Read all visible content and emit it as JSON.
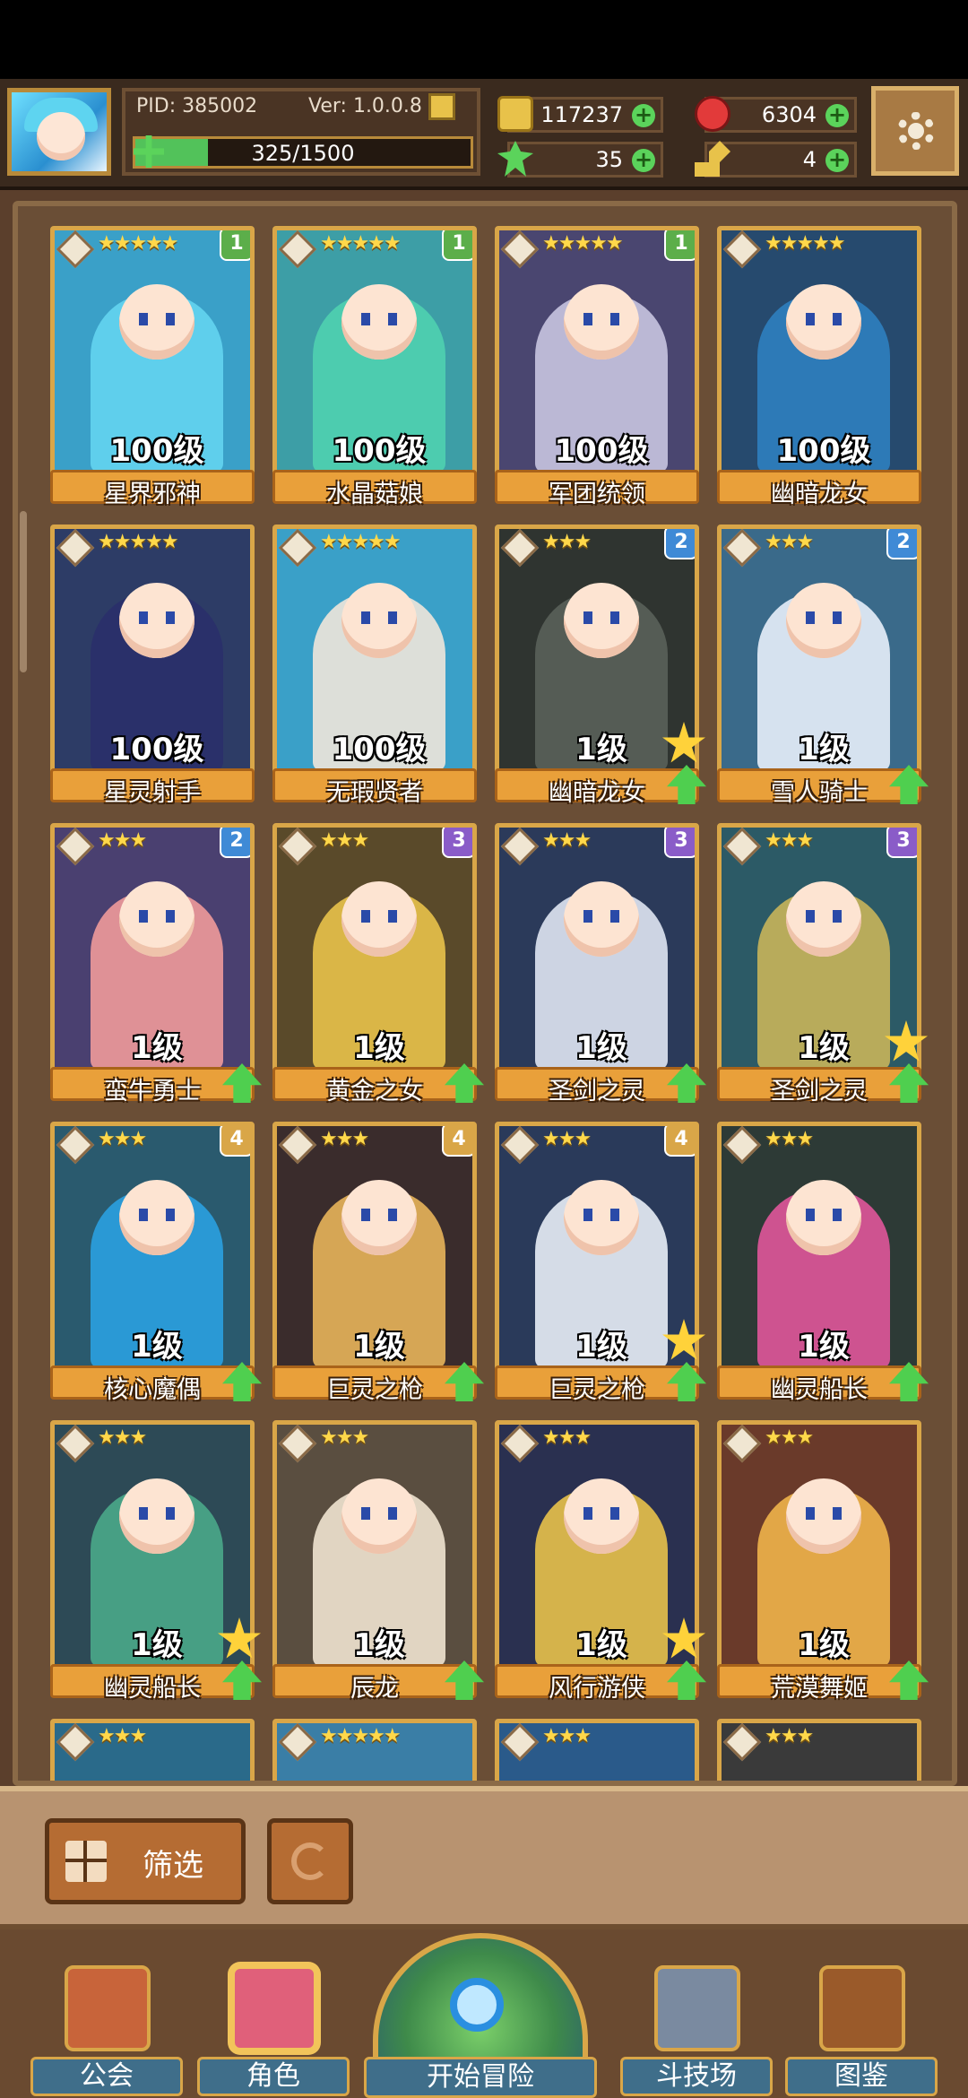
{
  "header": {
    "pid": "PID: 385002",
    "version": "Ver: 1.0.0.8",
    "exp_text": "325/1500",
    "exp_progress": 0.217,
    "gold": "117237",
    "gems": "6304",
    "clover": "35",
    "keys": "4"
  },
  "heroes": [
    {
      "name": "星界邪神",
      "level": "100级",
      "stars": "★★★★★",
      "tier": "1",
      "tier_color": "#5cae4a",
      "bg": "#3aa0c8",
      "hair": "#64d4ef"
    },
    {
      "name": "水晶菇娘",
      "level": "100级",
      "stars": "★★★★★",
      "tier": "1",
      "tier_color": "#5cae4a",
      "bg": "#3d9ea6",
      "hair": "#4fd0b0"
    },
    {
      "name": "军团统领",
      "level": "100级",
      "stars": "★★★★★",
      "tier": "1",
      "tier_color": "#5cae4a",
      "bg": "#4a4670",
      "hair": "#c8c4e0"
    },
    {
      "name": "幽暗龙女",
      "level": "100级",
      "stars": "★★★★★",
      "tier": "",
      "tier_color": "",
      "bg": "#264a6e",
      "hair": "#2f7fbf"
    },
    {
      "name": "星灵射手",
      "level": "100级",
      "stars": "★★★★★",
      "tier": "",
      "tier_color": "",
      "bg": "#2d3c66",
      "hair": "#2a2f6a"
    },
    {
      "name": "无瑕贤者",
      "level": "100级",
      "stars": "★★★★★",
      "tier": "",
      "tier_color": "",
      "bg": "#3aa0c8",
      "hair": "#efe6da"
    },
    {
      "name": "幽暗龙女",
      "level": "1级",
      "stars": "★★★",
      "tier": "2",
      "tier_color": "#3f8ad6",
      "bg": "#2f3430",
      "hair": "#5a605a"
    },
    {
      "name": "雪人骑士",
      "level": "1级",
      "stars": "★★★",
      "tier": "2",
      "tier_color": "#3f8ad6",
      "bg": "#3a6a8a",
      "hair": "#e8f0fa"
    },
    {
      "name": "蛮牛勇士",
      "level": "1级",
      "stars": "★★★",
      "tier": "2",
      "tier_color": "#3f8ad6",
      "bg": "#4a4070",
      "hair": "#f09a9a"
    },
    {
      "name": "黄金之女",
      "level": "1级",
      "stars": "★★★",
      "tier": "3",
      "tier_color": "#8a5cc8",
      "bg": "#5a4a2a",
      "hair": "#e8c24a"
    },
    {
      "name": "圣剑之灵",
      "level": "1级",
      "stars": "★★★",
      "tier": "3",
      "tier_color": "#8a5cc8",
      "bg": "#2b3a5a",
      "hair": "#dfe6f2"
    },
    {
      "name": "圣剑之灵",
      "level": "1级",
      "stars": "★★★",
      "tier": "3",
      "tier_color": "#8a5cc8",
      "bg": "#2c5a66",
      "hair": "#c8b45a"
    },
    {
      "name": "核心魔偶",
      "level": "1级",
      "stars": "★★★",
      "tier": "4",
      "tier_color": "#d9a648",
      "bg": "#2a5a6e",
      "hair": "#2aa0e0"
    },
    {
      "name": "巨灵之枪",
      "level": "1级",
      "stars": "★★★",
      "tier": "4",
      "tier_color": "#d9a648",
      "bg": "#3a2c2c",
      "hair": "#e8b45a"
    },
    {
      "name": "巨灵之枪",
      "level": "1级",
      "stars": "★★★",
      "tier": "4",
      "tier_color": "#d9a648",
      "bg": "#2a3a5a",
      "hair": "#e8eef6"
    },
    {
      "name": "幽灵船长",
      "level": "1级",
      "stars": "★★★",
      "tier": "",
      "tier_color": "",
      "bg": "#2d3a36",
      "hair": "#e0569a"
    },
    {
      "name": "幽灵船长",
      "level": "1级",
      "stars": "★★★",
      "tier": "",
      "tier_color": "",
      "bg": "#2d4a56",
      "hair": "#4aa88a"
    },
    {
      "name": "辰龙",
      "level": "1级",
      "stars": "★★★",
      "tier": "",
      "tier_color": "",
      "bg": "#5a4e40",
      "hair": "#efe4d0"
    },
    {
      "name": "风行游侠",
      "level": "1级",
      "stars": "★★★",
      "tier": "",
      "tier_color": "",
      "bg": "#2a3050",
      "hair": "#e8c24a"
    },
    {
      "name": "荒漠舞姬",
      "level": "1级",
      "stars": "★★★",
      "tier": "",
      "tier_color": "",
      "bg": "#6a3a2a",
      "hair": "#f0b44a"
    }
  ],
  "partial_row": [
    {
      "stars": "★★★",
      "bg": "#2a6a8a"
    },
    {
      "stars": "★★★★★",
      "bg": "#3a7ea6"
    },
    {
      "stars": "★★★",
      "bg": "#2a5a8a"
    },
    {
      "stars": "★★★",
      "bg": "#3a3a3a"
    }
  ],
  "filter": {
    "label": "筛选"
  },
  "nav": {
    "guild": "公会",
    "character": "角色",
    "adventure": "开始冒险",
    "arena": "斗技场",
    "codex": "图鉴"
  }
}
